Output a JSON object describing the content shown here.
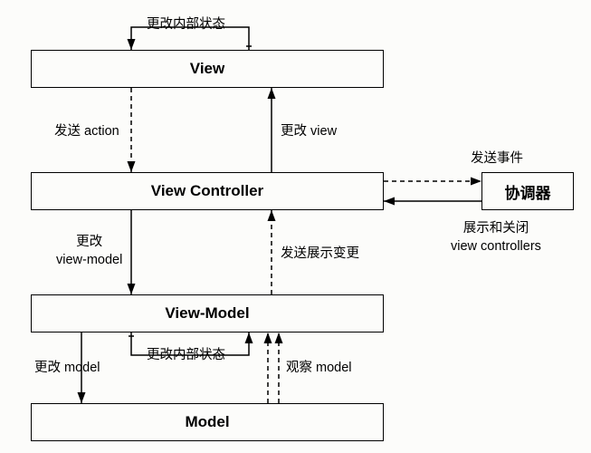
{
  "boxes": {
    "view": "View",
    "viewController": "View Controller",
    "viewModel": "View-Model",
    "model": "Model",
    "coordinator": "协调器"
  },
  "labels": {
    "viewSelf": "更改内部状态",
    "sendAction": "发送 action",
    "changeView": "更改 view",
    "sendEvent": "发送事件",
    "showClose": "展示和关闭\nview controllers",
    "changeViewModel": "更改\nview-model",
    "sendDisplayChange": "发送展示变更",
    "vmSelf": "更改内部状态",
    "changeModel": "更改 model",
    "observeModel": "观察 model"
  }
}
